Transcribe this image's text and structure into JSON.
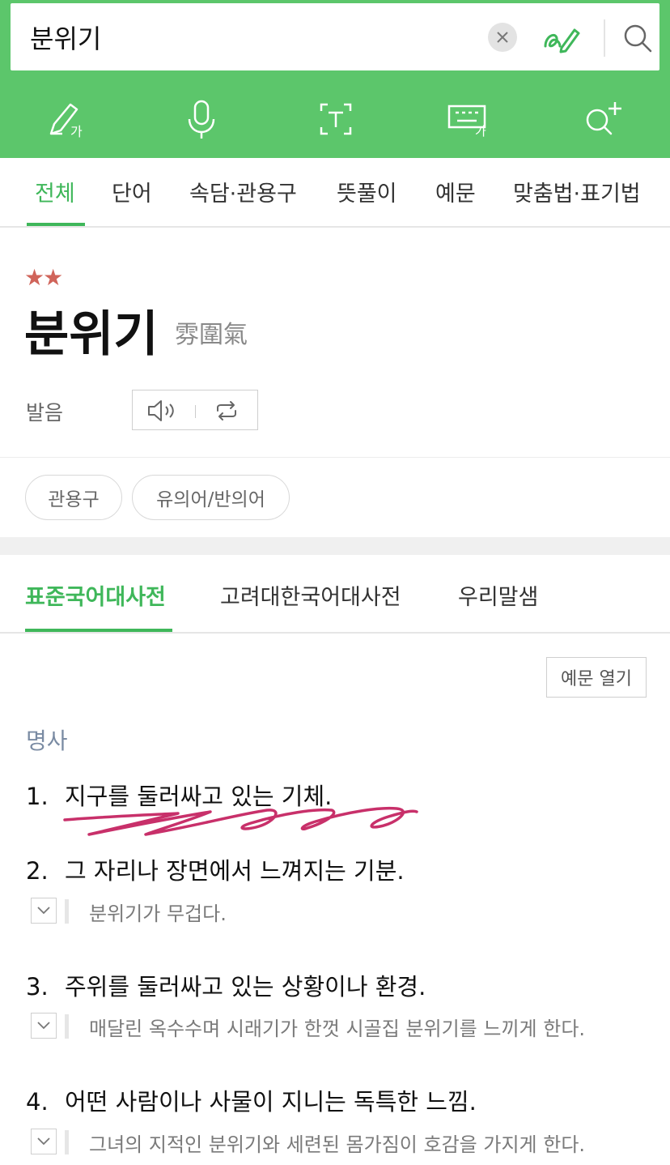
{
  "search": {
    "query": "분위기"
  },
  "icons": {
    "clear": "clear-x-icon",
    "handwriting": "pen-scribble-icon",
    "search": "magnifier-icon",
    "tools": [
      "handwriting-input-icon",
      "voice-mic-icon",
      "text-scan-icon",
      "keyboard-icon",
      "advanced-search-icon"
    ]
  },
  "colors": {
    "brand_green": "#5cc66b",
    "active_green": "#3fb75a",
    "star_red": "#d0645a",
    "annotation_pink": "#c8306a"
  },
  "tabs": [
    {
      "label": "전체",
      "active": true
    },
    {
      "label": "단어"
    },
    {
      "label": "속담·관용구"
    },
    {
      "label": "뜻풀이"
    },
    {
      "label": "예문"
    },
    {
      "label": "맞춤법·표기법"
    }
  ],
  "entry": {
    "stars": "★★",
    "headword": "분위기",
    "hanja": "雰圍氣",
    "pronunciation_label": "발음"
  },
  "chips": [
    "관용구",
    "유의어/반의어"
  ],
  "dict_tabs": [
    {
      "label": "표준국어대사전",
      "active": true
    },
    {
      "label": "고려대한국어대사전"
    },
    {
      "label": "우리말샘"
    }
  ],
  "example_button": "예문 열기",
  "pos": "명사",
  "definitions": [
    {
      "num": "1.",
      "text": "지구를 둘러싸고 있는 기체."
    },
    {
      "num": "2.",
      "text": "그 자리나 장면에서 느껴지는 기분.",
      "example": "분위기가 무겁다."
    },
    {
      "num": "3.",
      "text": "주위를 둘러싸고 있는 상황이나 환경.",
      "example": "매달린 옥수수며 시래기가 한껏 시골집 분위기를 느끼게 한다."
    },
    {
      "num": "4.",
      "text": "어떤 사람이나 사물이 지니는 독특한 느낌.",
      "example": "그녀의 지적인 분위기와 세련된 몸가짐이 호감을 가지게 한다."
    }
  ]
}
